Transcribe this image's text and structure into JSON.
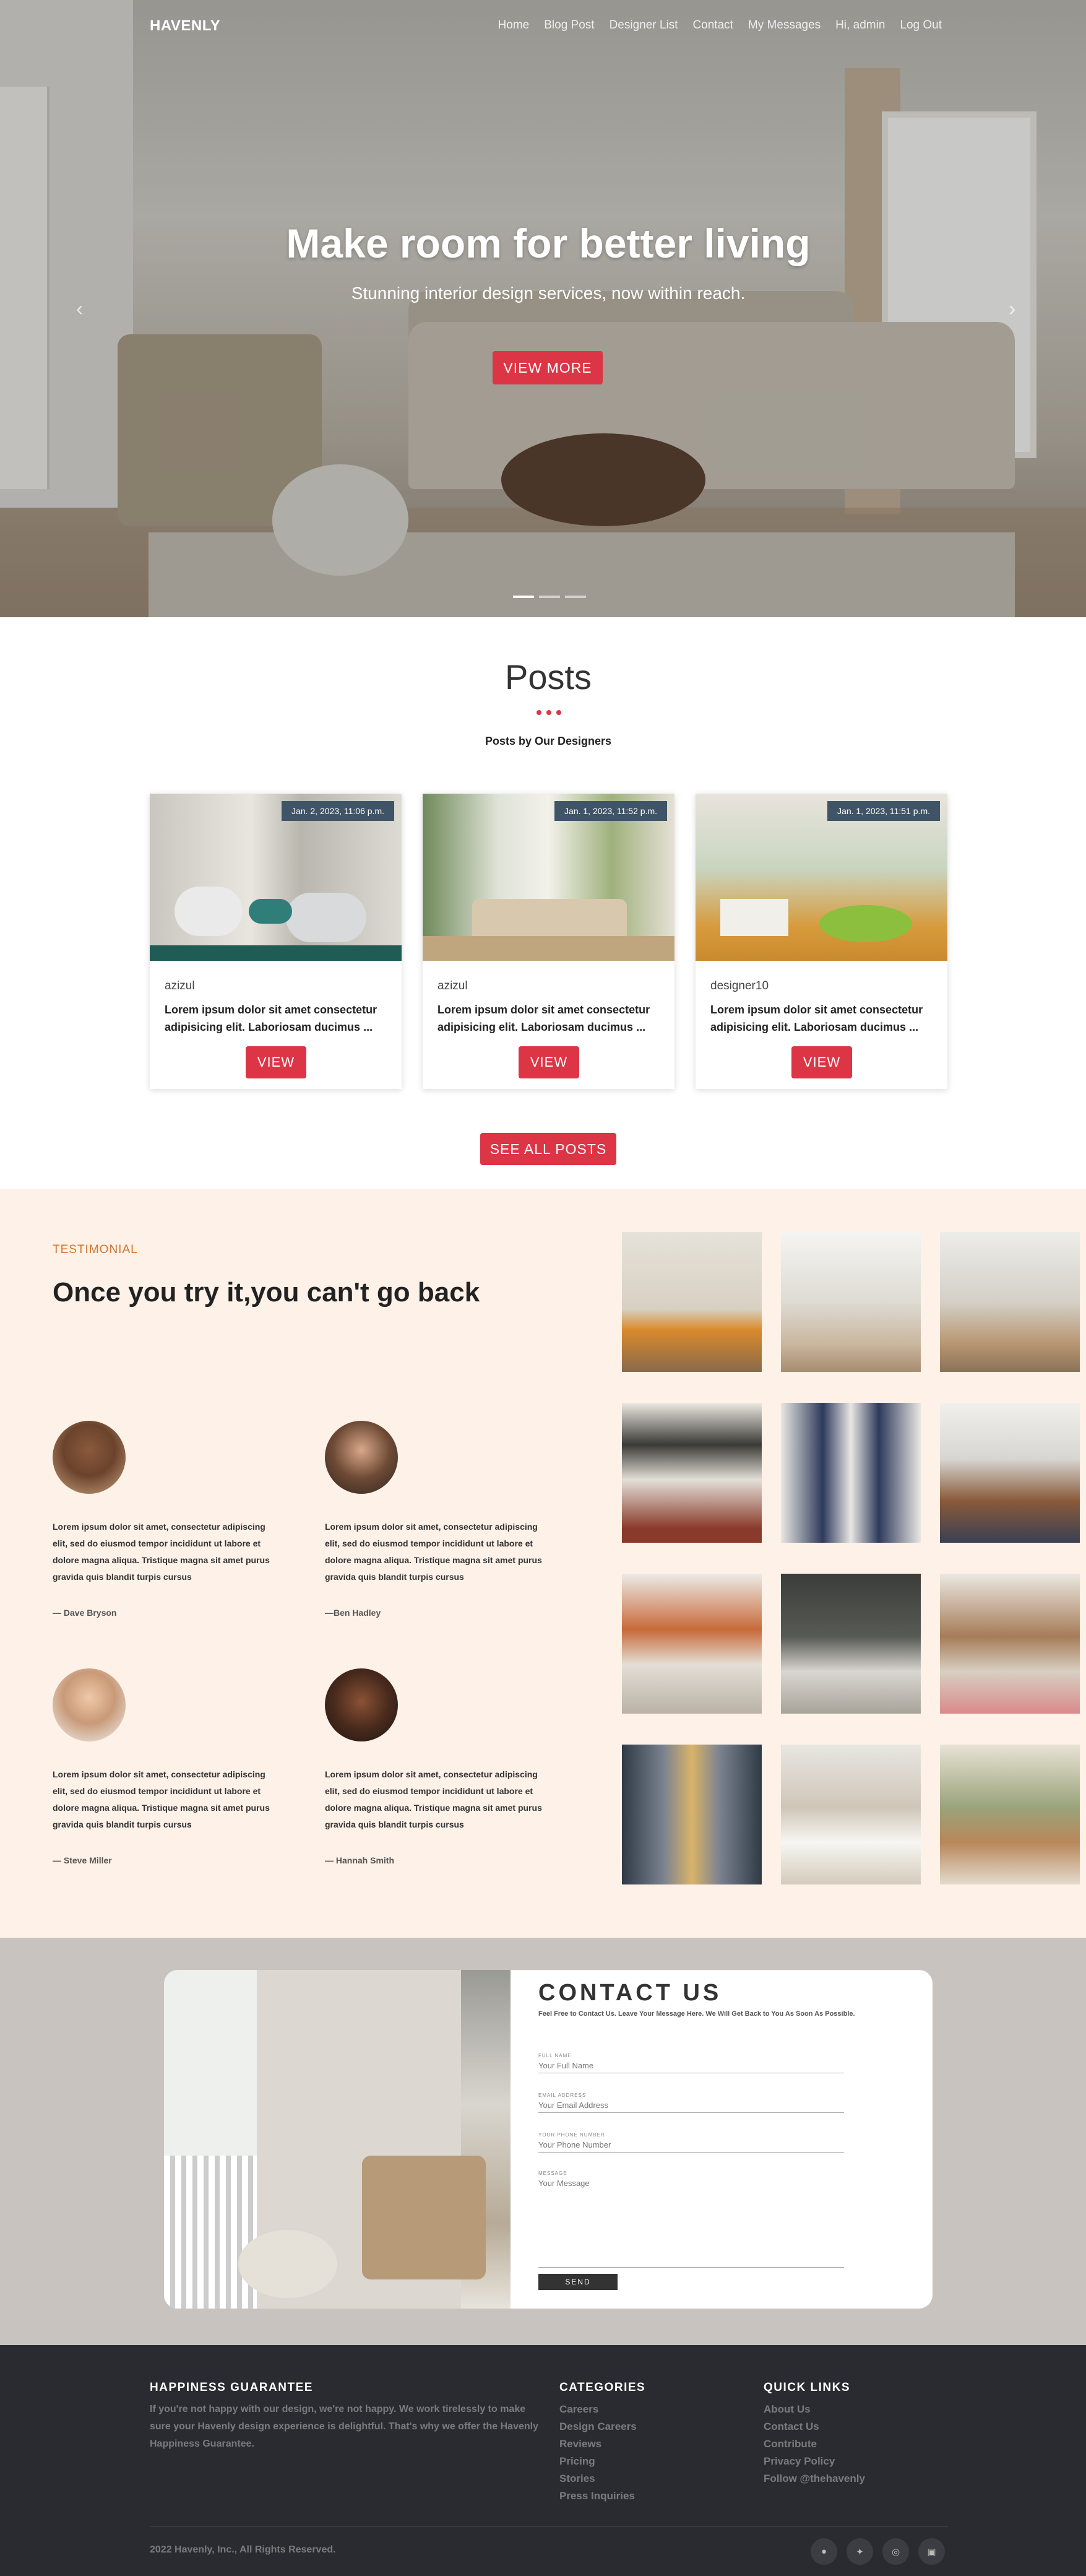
{
  "nav": {
    "brand": "HAVENLY",
    "links": [
      "Home",
      "Blog Post",
      "Designer List",
      "Contact",
      "My Messages",
      "Hi, admin",
      "Log Out"
    ]
  },
  "hero": {
    "title": "Make room for better living",
    "subtitle": "Stunning interior design services, now within reach.",
    "button": "VIEW MORE",
    "prev_icon": "chevron-left-icon",
    "next_icon": "chevron-right-icon",
    "slides": 3,
    "active_slide": 1
  },
  "posts": {
    "title": "Posts",
    "subtitle": "Posts by Our Designers",
    "cards": [
      {
        "date": "Jan. 2, 2023, 11:06 p.m.",
        "author": "azizul",
        "excerpt": "Lorem ipsum dolor sit amet consectetur adipisicing elit. Laboriosam ducimus ...",
        "button": "VIEW"
      },
      {
        "date": "Jan. 1, 2023, 11:52 p.m.",
        "author": "azizul",
        "excerpt": "Lorem ipsum dolor sit amet consectetur adipisicing elit. Laboriosam ducimus ...",
        "button": "VIEW"
      },
      {
        "date": "Jan. 1, 2023, 11:51 p.m.",
        "author": "designer10",
        "excerpt": "Lorem ipsum dolor sit amet consectetur adipisicing elit. Laboriosam ducimus ...",
        "button": "VIEW"
      }
    ],
    "see_all": "SEE ALL POSTS"
  },
  "testimonial": {
    "label": "TESTIMONIAL",
    "heading": "Once you try it,you can't go back",
    "items": [
      {
        "quote": "Lorem ipsum dolor sit amet, consectetur adipiscing elit, sed do eiusmod tempor incididunt ut labore et dolore magna aliqua. Tristique magna sit amet purus gravida quis blandit turpis cursus",
        "who": "— Dave Bryson"
      },
      {
        "quote": "Lorem ipsum dolor sit amet, consectetur adipiscing elit, sed do eiusmod tempor incididunt ut labore et dolore magna aliqua. Tristique magna sit amet purus gravida quis blandit turpis cursus",
        "who": "—Ben Hadley"
      },
      {
        "quote": "Lorem ipsum dolor sit amet, consectetur adipiscing elit, sed do eiusmod tempor incididunt ut labore et dolore magna aliqua. Tristique magna sit amet purus gravida quis blandit turpis cursus",
        "who": "— Steve Miller"
      },
      {
        "quote": "Lorem ipsum dolor sit amet, consectetur adipiscing elit, sed do eiusmod tempor incididunt ut labore et dolore magna aliqua. Tristique magna sit amet purus gravida quis blandit turpis cursus",
        "who": "— Hannah Smith"
      }
    ],
    "gallery_count": 12
  },
  "contact": {
    "title": "CONTACT US",
    "subtitle": "Feel Free to Contact Us. Leave Your Message Here. We Will Get Back to You As Soon As Possible.",
    "fields": [
      {
        "label": "FULL NAME",
        "placeholder": "Your Full Name"
      },
      {
        "label": "EMAIL ADDRESS",
        "placeholder": "Your Email Address"
      },
      {
        "label": "YOUR PHONE NUMBER",
        "placeholder": "Your Phone Number"
      },
      {
        "label": "MESSAGE",
        "placeholder": "Your Message"
      }
    ],
    "send": "SEND"
  },
  "footer": {
    "guarantee_title": "HAPPINESS GUARANTEE",
    "guarantee_text": "If you're not happy with our design, we're not happy. We work tirelessly to make sure your Havenly design experience is delightful. That's why we offer the Havenly Happiness Guarantee.",
    "categories_title": "CATEGORIES",
    "categories": [
      "Careers",
      "Design Careers",
      "Reviews",
      "Pricing",
      "Stories",
      "Press Inquiries"
    ],
    "quick_title": "QUICK LINKS",
    "quick_links": [
      "About Us",
      "Contact Us",
      "Contribute",
      "Privacy Policy",
      "Follow @thehavenly"
    ],
    "copyright": "2022 Havenly, Inc., All Rights Reserved.",
    "socials": [
      "github-icon",
      "twitter-icon",
      "dribbble-icon",
      "linkedin-icon"
    ]
  },
  "colors": {
    "accent": "#dc3545",
    "testimonial_bg": "#fdf1e8",
    "footer_bg": "#2a2b30",
    "contact_bg": "#c8c3bf",
    "date_badge": "#3f5466"
  }
}
